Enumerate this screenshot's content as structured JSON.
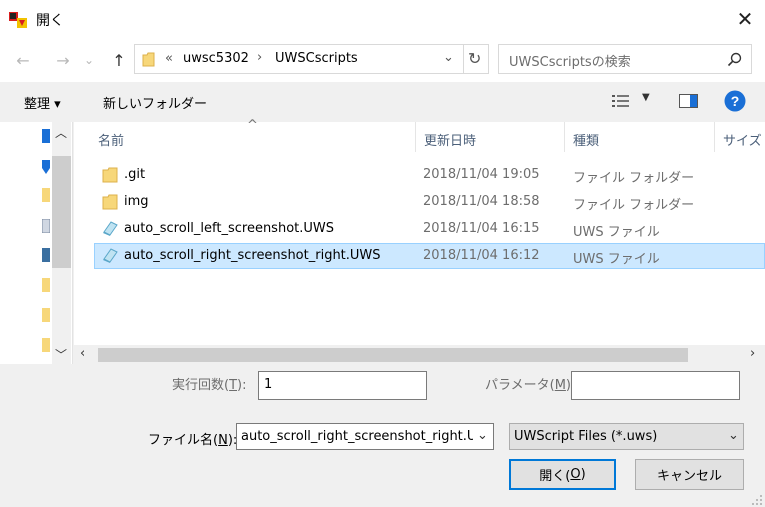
{
  "window": {
    "title": "開く",
    "close_glyph": "✕"
  },
  "nav": {
    "back_glyph": "←",
    "forward_glyph": "→",
    "recent_glyph": "⌄",
    "up_glyph": "↑",
    "breadcrumb_sep": "«",
    "path": [
      "uwsc5302",
      "UWSCscripts"
    ],
    "path_arrow": "›",
    "dropdown_glyph": "⌄",
    "refresh_glyph": "↻",
    "search_placeholder": "UWSCscriptsの検索"
  },
  "toolbar": {
    "organize_label": "整理 ▾",
    "new_folder_label": "新しいフォルダー"
  },
  "columns": {
    "name": "名前",
    "date": "更新日時",
    "type": "種類",
    "size": "サイズ",
    "sort_glyph": "^"
  },
  "files": [
    {
      "name": ".git",
      "date": "2018/11/04 19:05",
      "type": "ファイル フォルダー",
      "icon": "folder-icon",
      "selected": false
    },
    {
      "name": "img",
      "date": "2018/11/04 18:58",
      "type": "ファイル フォルダー",
      "icon": "folder-icon",
      "selected": false
    },
    {
      "name": "auto_scroll_left_screenshot.UWS",
      "date": "2018/11/04 16:15",
      "type": "UWS ファイル",
      "icon": "uws-file-icon",
      "selected": false
    },
    {
      "name": "auto_scroll_right_screenshot_right.UWS",
      "date": "2018/11/04 16:12",
      "type": "UWS ファイル",
      "icon": "uws-file-icon",
      "selected": true
    }
  ],
  "bottom": {
    "exec_count_label": "実行回数(",
    "exec_count_key": "T",
    "exec_count_label_end": "):",
    "exec_count_value": "1",
    "param_label": "パラメータ(",
    "param_key": "M",
    "param_label_end": "):",
    "param_value": "",
    "filename_label": "ファイル名(",
    "filename_key": "N",
    "filename_label_end": "):",
    "filename_value": "auto_scroll_right_screenshot_right.U",
    "filter_value": "UWScript Files (*.uws)",
    "open_label": "開く(",
    "open_key": "O",
    "open_label_end": ")",
    "cancel_label": "キャンセル"
  },
  "colors": {
    "accent": "#0078d7",
    "selection": "#cce8ff",
    "help": "#1a6fd6"
  }
}
